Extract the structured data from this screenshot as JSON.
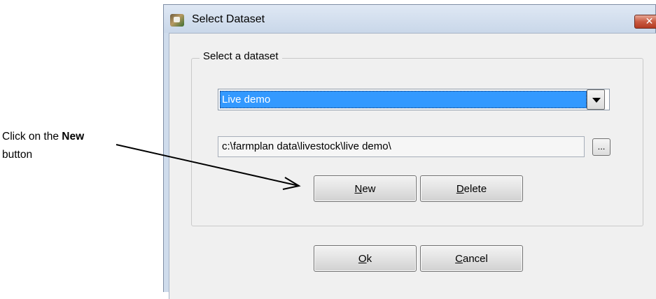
{
  "annotation": {
    "text_before": "Click on the ",
    "text_bold": "New",
    "text_after": "button"
  },
  "dialog": {
    "title": "Select Dataset",
    "close_label": "✕",
    "group_label": "Select a dataset",
    "dataset_selected": "Live demo",
    "dataset_path": "c:\\farmplan data\\livestock\\live demo\\",
    "browse_label": "...",
    "buttons": {
      "new": {
        "mnemonic": "N",
        "rest": "ew"
      },
      "delete": {
        "mnemonic": "D",
        "rest": "elete"
      },
      "ok": {
        "mnemonic": "O",
        "rest": "k"
      },
      "cancel": {
        "mnemonic": "C",
        "rest": "ancel"
      }
    }
  },
  "colors": {
    "selection": "#3399ff",
    "close_button": "#c95a41",
    "titlebar": "#cfdcec"
  }
}
